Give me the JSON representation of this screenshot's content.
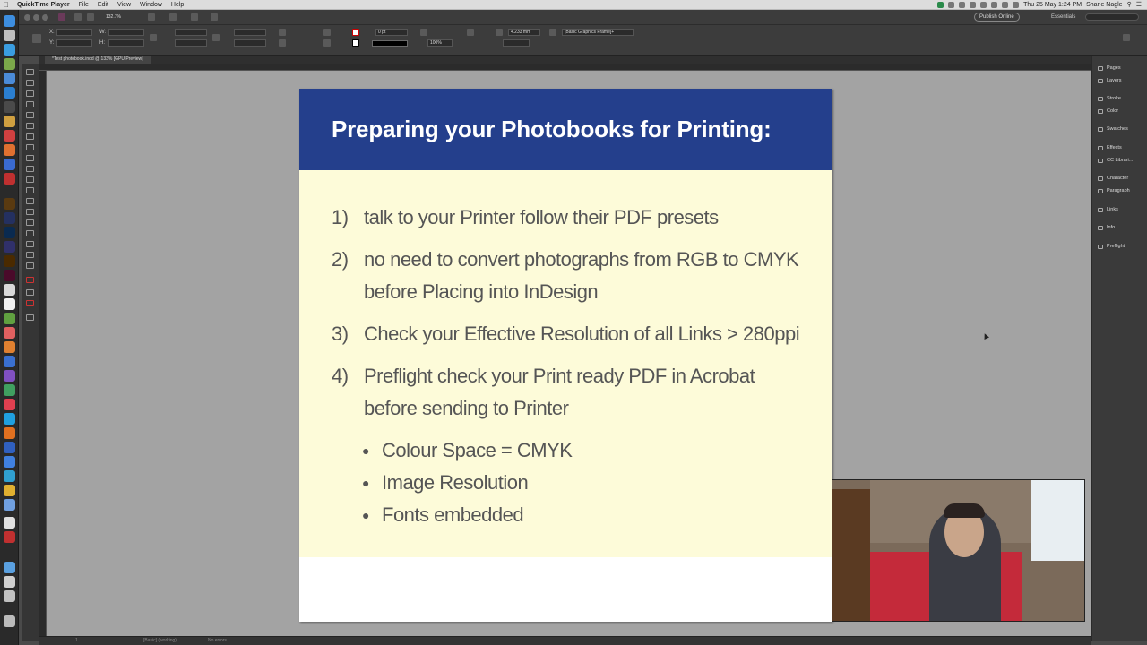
{
  "menubar": {
    "app": "QuickTime Player",
    "items": [
      "File",
      "Edit",
      "View",
      "Window",
      "Help"
    ],
    "clock": "Thu 25 May 1:24 PM",
    "user": "Shane Nagle"
  },
  "control_bar": {
    "zoom": "132.7%",
    "publish_button": "Publish Online",
    "workspace": "Essentials",
    "stroke_weight": "0 pt",
    "gap_value": "4.233 mm",
    "scale_percent": "100%",
    "object_style": "[Basic Graphics Frame]+"
  },
  "document_tab": {
    "label": "*Test photobook.indd @ 133% [GPU Preview]"
  },
  "page": {
    "title": "Preparing your Photobooks for Printing:",
    "items": [
      {
        "num": "1)",
        "lines": [
          "talk to your Printer follow their PDF presets"
        ]
      },
      {
        "num": "2)",
        "lines": [
          "no need to convert photographs from RGB to CMYK",
          "before Placing into InDesign"
        ]
      },
      {
        "num": "3)",
        "lines": [
          "Check your Effective Resolution of all Links > 280ppi"
        ]
      },
      {
        "num": "4)",
        "lines": [
          "Preflight check your Print ready PDF in Acrobat",
          "before sending to Printer"
        ]
      }
    ],
    "bullets": [
      "Colour Space = CMYK",
      "Image Resolution",
      "Fonts embedded"
    ],
    "colors": {
      "banner": "#243f8c",
      "cream": "#fdfbd9",
      "text": "#555555"
    }
  },
  "panels": {
    "items": [
      "Pages",
      "Layers",
      "Stroke",
      "Color",
      "Swatches",
      "Effects",
      "CC Librari...",
      "Character",
      "Paragraph",
      "Links",
      "Info",
      "Preflight"
    ]
  },
  "statusbar": {
    "page": "1",
    "style": "[Basic] (working)",
    "errors": "No errors"
  }
}
